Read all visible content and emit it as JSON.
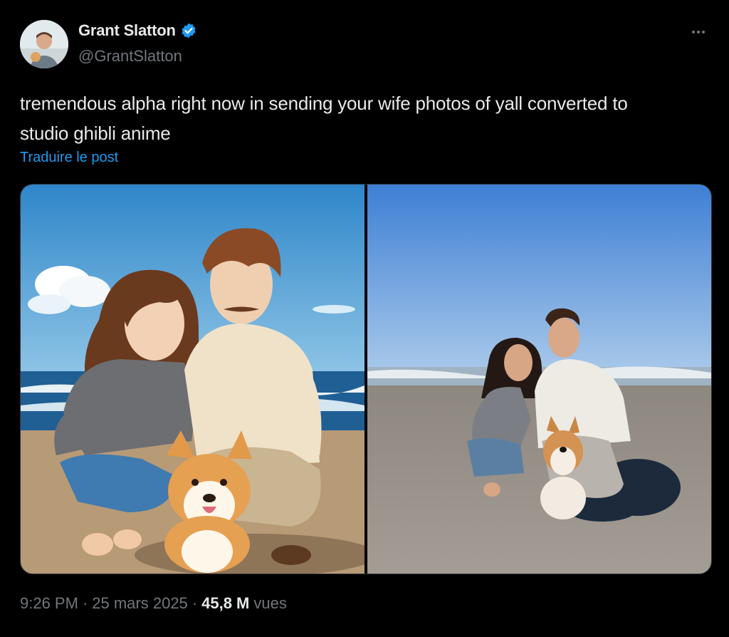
{
  "author": {
    "display_name": "Grant Slatton",
    "handle": "@GrantSlatton",
    "verified": true,
    "avatar_icon": "profile-photo"
  },
  "tweet": {
    "text": "tremendous alpha right now in sending your wife photos of yall converted to studio ghibli anime",
    "translate_label": "Traduire le post"
  },
  "media": [
    {
      "kind": "anime-illustration",
      "icon": "anime-couple-with-corgi-on-beach"
    },
    {
      "kind": "photo",
      "icon": "couple-with-corgi-on-beach-photo"
    }
  ],
  "meta": {
    "time": "9:26 PM",
    "separator": "·",
    "date": "25 mars 2025",
    "views_count": "45,8 M",
    "views_label": "vues"
  },
  "colors": {
    "background": "#000000",
    "text": "#e7e9ea",
    "muted": "#71767b",
    "link": "#1d9bf0",
    "verified": "#1d9bf0"
  }
}
